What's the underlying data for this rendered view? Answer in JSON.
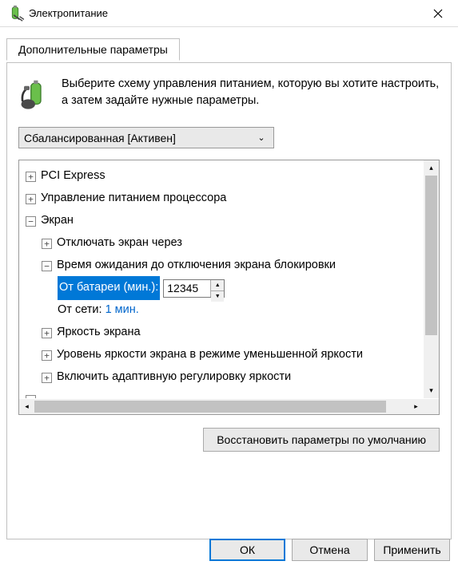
{
  "window": {
    "title": "Электропитание"
  },
  "tab": {
    "label": "Дополнительные параметры"
  },
  "intro": {
    "text": "Выберите схему управления питанием, которую вы хотите настроить, а затем задайте нужные параметры."
  },
  "scheme": {
    "selected": "Сбалансированная [Активен]"
  },
  "tree": {
    "pci": "PCI Express",
    "cpu": "Управление питанием процессора",
    "screen": "Экран",
    "turnoff": "Отключать экран через",
    "lockwait": "Время ожидания до отключения экрана блокировки",
    "battery_label": "От батареи (мин.):",
    "battery_value": "12345",
    "ac_label": "От сети:",
    "ac_value": "1 мин.",
    "brightness": "Яркость экрана",
    "dimbrightness": "Уровень яркости экрана в режиме уменьшенной яркости",
    "adaptive": "Включить адаптивную регулировку яркости"
  },
  "restore": {
    "label": "Восстановить параметры по умолчанию"
  },
  "buttons": {
    "ok": "ОК",
    "cancel": "Отмена",
    "apply": "Применить"
  }
}
